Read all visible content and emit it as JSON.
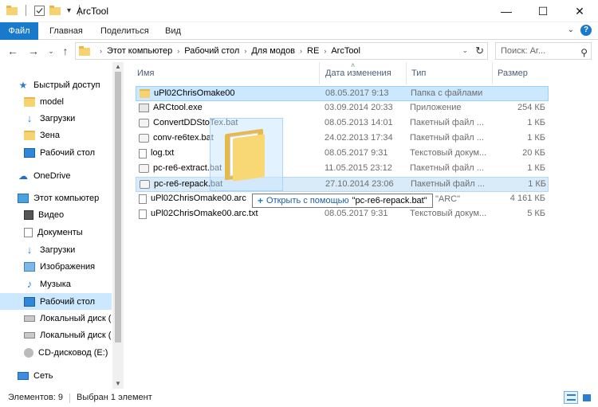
{
  "window": {
    "title": "ArcTool",
    "minimize_glyph": "—",
    "maximize_glyph": "☐",
    "close_glyph": "✕"
  },
  "ribbon": {
    "tabs": [
      "Файл",
      "Главная",
      "Поделиться",
      "Вид"
    ],
    "help": "?"
  },
  "nav": {
    "breadcrumbs": [
      "Этот компьютер",
      "Рабочий стол",
      "Для модов",
      "RE",
      "ArcTool"
    ],
    "search_placeholder": "Поиск: Ar..."
  },
  "navpane": {
    "items": [
      {
        "label": "Быстрый доступ",
        "icon": "star-icon",
        "level": 0
      },
      {
        "label": "model",
        "icon": "folder-icon",
        "level": 1
      },
      {
        "label": "Загрузки",
        "icon": "download-icon",
        "level": 1
      },
      {
        "label": "Зена",
        "icon": "folder-icon",
        "level": 1
      },
      {
        "label": "Рабочий стол",
        "icon": "desktop-icon",
        "level": 1
      },
      {
        "label": "OneDrive",
        "icon": "cloud-icon",
        "level": 0
      },
      {
        "label": "Этот компьютер",
        "icon": "computer-icon",
        "level": 0
      },
      {
        "label": "Видео",
        "icon": "video-icon",
        "level": 1
      },
      {
        "label": "Документы",
        "icon": "documents-icon",
        "level": 1
      },
      {
        "label": "Загрузки",
        "icon": "download-icon",
        "level": 1
      },
      {
        "label": "Изображения",
        "icon": "pictures-icon",
        "level": 1
      },
      {
        "label": "Музыка",
        "icon": "music-icon",
        "level": 1
      },
      {
        "label": "Рабочий стол",
        "icon": "desktop-icon",
        "level": 1,
        "selected": true
      },
      {
        "label": "Локальный диск (C",
        "icon": "drive-icon",
        "level": 1
      },
      {
        "label": "Локальный диск (D",
        "icon": "drive-icon",
        "level": 1
      },
      {
        "label": "CD-дисковод (E:)",
        "icon": "cd-drive-icon",
        "level": 1
      },
      {
        "label": "Сеть",
        "icon": "network-icon",
        "level": 0
      }
    ]
  },
  "columns": {
    "name": "Имя",
    "date": "Дата изменения",
    "type": "Тип",
    "size": "Размер"
  },
  "files": [
    {
      "name": "uPl02ChrisOmake00",
      "date": "08.05.2017 9:13",
      "type": "Папка с файлами",
      "size": "",
      "icon": "folder-icon",
      "state": "selected"
    },
    {
      "name": "ARCtool.exe",
      "date": "03.09.2014 20:33",
      "type": "Приложение",
      "size": "254 КБ",
      "icon": "exe-icon",
      "state": ""
    },
    {
      "name": "ConvertDDStoTex.bat",
      "date": "08.05.2013 14:01",
      "type": "Пакетный файл ...",
      "size": "1 КБ",
      "icon": "bat-icon",
      "state": ""
    },
    {
      "name": "conv-re6tex.bat",
      "date": "24.02.2013 17:34",
      "type": "Пакетный файл ...",
      "size": "1 КБ",
      "icon": "bat-icon",
      "state": ""
    },
    {
      "name": "log.txt",
      "date": "08.05.2017 9:31",
      "type": "Текстовый докум...",
      "size": "20 КБ",
      "icon": "txt-icon",
      "state": ""
    },
    {
      "name": "pc-re6-extract.bat",
      "date": "11.05.2015 23:12",
      "type": "Пакетный файл ...",
      "size": "1 КБ",
      "icon": "bat-icon",
      "state": ""
    },
    {
      "name": "pc-re6-repack.bat",
      "date": "27.10.2014 23:06",
      "type": "Пакетный файл ...",
      "size": "1 КБ",
      "icon": "bat-icon",
      "state": "hover"
    },
    {
      "name": "uPl02ChrisOmake00.arc",
      "date": "",
      "type": "",
      "size": "4 161 КБ",
      "icon": "file-icon",
      "state": ""
    },
    {
      "name": "uPl02ChrisOmake00.arc.txt",
      "date": "08.05.2017 9:31",
      "type": "Текстовый докум...",
      "size": "5 КБ",
      "icon": "txt-icon",
      "state": ""
    }
  ],
  "arc_type_partial": "\"ARC\"",
  "drag_tooltip": {
    "verb": "Открыть с помощью",
    "target": "\"pc-re6-repack.bat\""
  },
  "status": {
    "count": "Элементов: 9",
    "selected": "Выбран 1 элемент"
  },
  "colors": {
    "accent": "#1979ca",
    "selection": "#cce8ff",
    "hover": "#d9ebf9"
  }
}
